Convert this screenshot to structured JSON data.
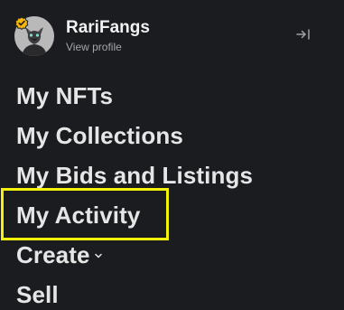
{
  "profile": {
    "username": "RariFangs",
    "link_label": "View profile",
    "avatar_icon": "wolf-avatar",
    "verified_icon": "verified-badge-icon",
    "verified_color": "#f5b50a"
  },
  "header": {
    "collapse_icon": "collapse-sidebar-icon"
  },
  "menu": {
    "items": [
      {
        "label": "My NFTs"
      },
      {
        "label": "My Collections"
      },
      {
        "label": "My Bids and Listings"
      },
      {
        "label": "My Activity"
      },
      {
        "label": "Create",
        "icon": "chevron-down-icon"
      },
      {
        "label": "Sell"
      }
    ]
  },
  "colors": {
    "background": "#1a1c1f",
    "text": "#e6e6e7",
    "highlight": "#f4f10a"
  }
}
